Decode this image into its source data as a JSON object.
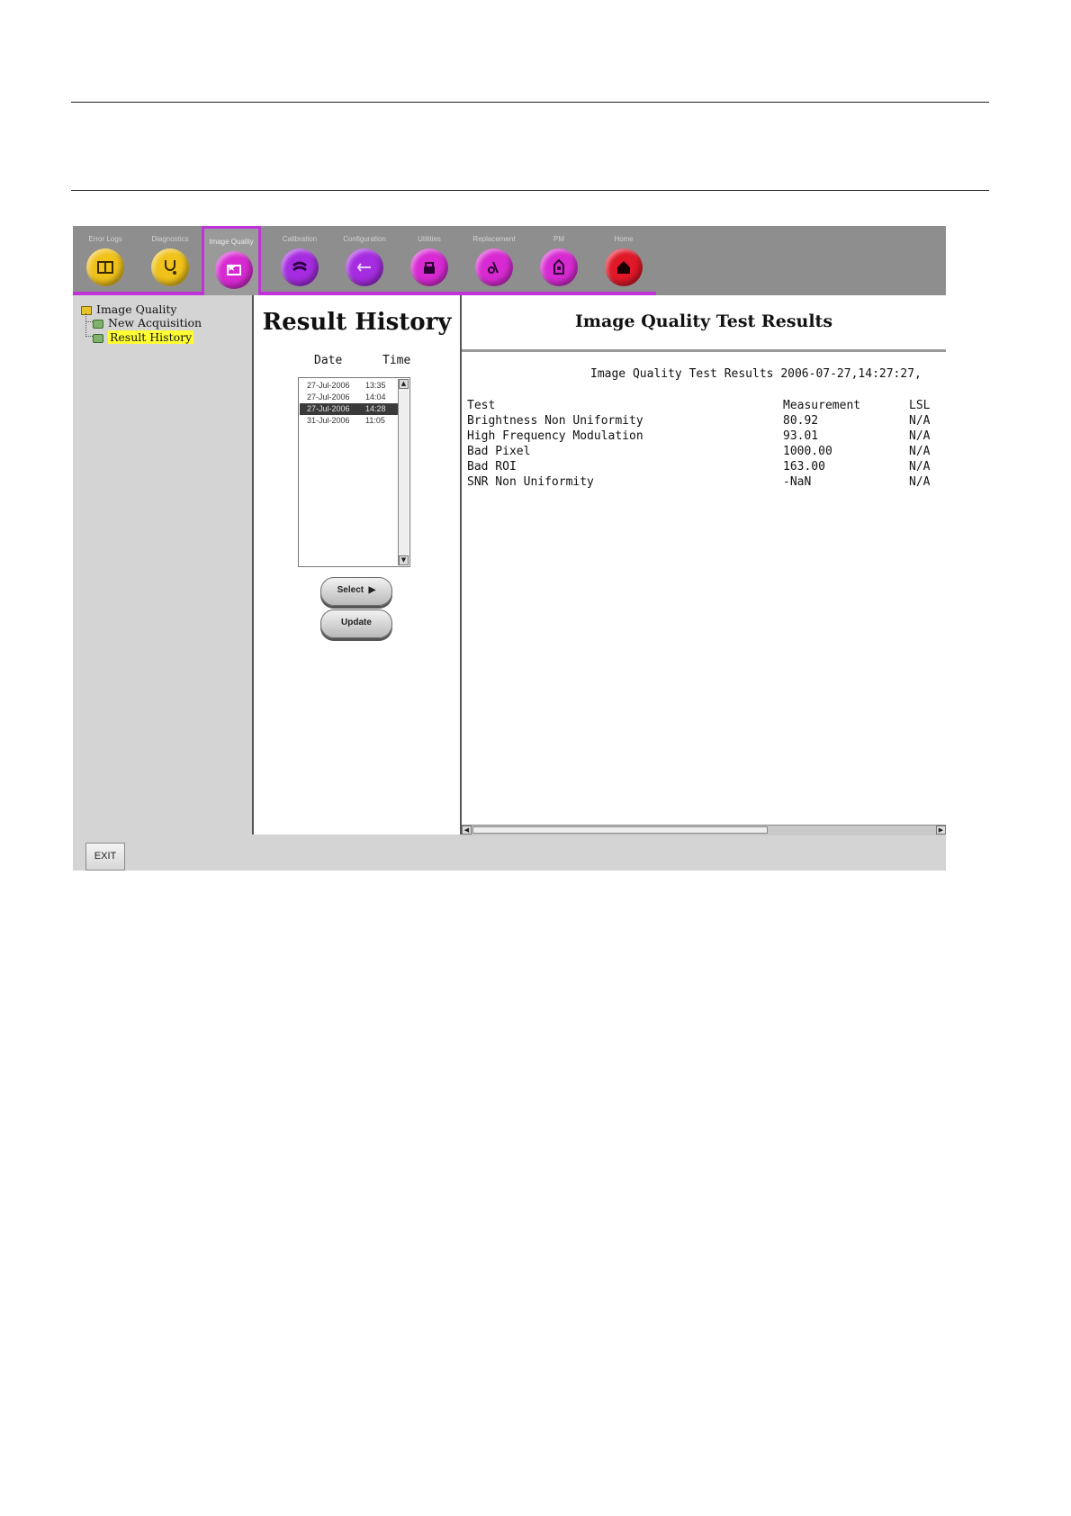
{
  "toolbar": {
    "tools": [
      {
        "label": "Error Logs",
        "icon": "logbook-icon",
        "color": "#f0c21a"
      },
      {
        "label": "Diagnostics",
        "icon": "stethoscope-icon",
        "color": "#f0c21a"
      },
      {
        "label": "Image Quality",
        "icon": "image-quality-icon",
        "color": "#d82ad2"
      },
      {
        "label": "Calibration",
        "icon": "calibration-icon",
        "color": "#a52ce0"
      },
      {
        "label": "Configuration",
        "icon": "configuration-icon",
        "color": "#a52ce0"
      },
      {
        "label": "Utilities",
        "icon": "utilities-icon",
        "color": "#d82ad2"
      },
      {
        "label": "Replacement",
        "icon": "replacement-icon",
        "color": "#d82ad2"
      },
      {
        "label": "PM",
        "icon": "pm-icon",
        "color": "#d82ad2"
      },
      {
        "label": "Home",
        "icon": "home-icon",
        "color": "#e01828"
      }
    ],
    "active": "Image Quality",
    "accent_color": "#c033d8"
  },
  "tree": {
    "root": "Image Quality",
    "items": [
      "New Acquisition",
      "Result History"
    ],
    "selected": "Result History"
  },
  "history": {
    "title": "Result History",
    "col_date": "Date",
    "col_time": "Time",
    "rows": [
      {
        "date": "27-Jul-2006",
        "time": "13:35"
      },
      {
        "date": "27-Jul-2006",
        "time": "14:04"
      },
      {
        "date": "27-Jul-2006",
        "time": "14:28"
      },
      {
        "date": "31-Jul-2006",
        "time": "11:05"
      }
    ],
    "selected_row": 2,
    "select_label": "Select",
    "update_label": "Update"
  },
  "results": {
    "title": "Image Quality Test Results",
    "subtitle": "Image Quality Test Results 2006-07-27,14:27:27,",
    "headers": [
      "Test",
      "Measurement",
      "LSL"
    ],
    "rows": [
      [
        "Brightness Non Uniformity",
        "80.92",
        "N/A"
      ],
      [
        "High Frequency Modulation",
        "93.01",
        "N/A"
      ],
      [
        "Bad Pixel",
        "1000.00",
        "N/A"
      ],
      [
        "Bad ROI",
        "163.00",
        "N/A"
      ],
      [
        "SNR Non Uniformity",
        "-NaN",
        "N/A"
      ]
    ]
  },
  "footer": {
    "exit_label": "EXIT"
  }
}
